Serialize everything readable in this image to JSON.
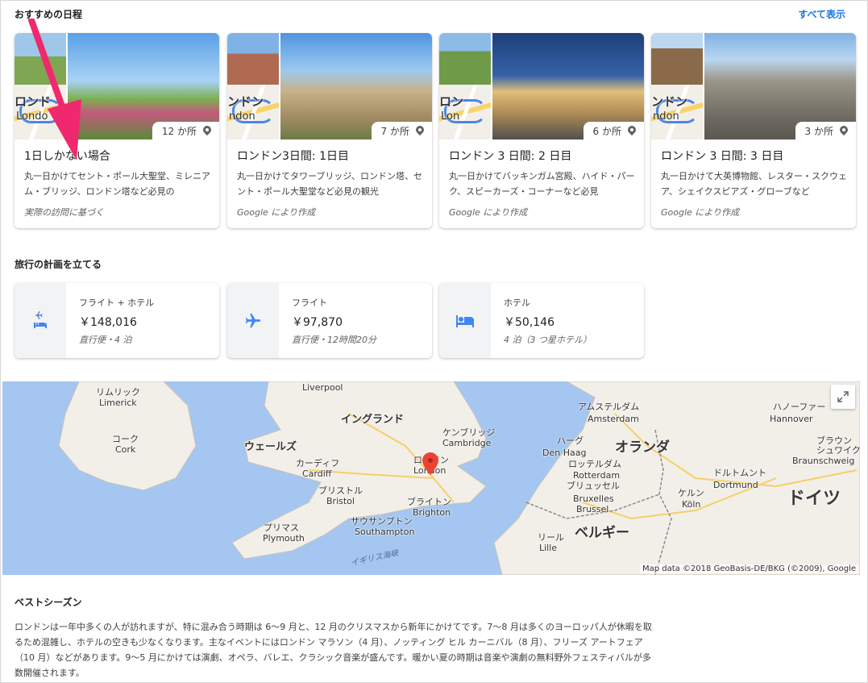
{
  "itineraries": {
    "heading": "おすすめの日程",
    "see_all": "すべて表示",
    "cards": [
      {
        "title": "1日しかない場合",
        "count": "12 か所",
        "map_city": "ロンド",
        "map_city2": "Londo",
        "desc": "丸一日かけてセント・ポール大聖堂、ミレニアム・ブリッジ、ロンドン塔など必見の",
        "source": "実際の訪問に基づく"
      },
      {
        "title": "ロンドン3日間: 1日目",
        "count": "7 か所",
        "map_city": "ンドン",
        "map_city2": "ndon",
        "desc": "丸一日かけてタワーブリッジ、ロンドン塔、セント・ポール大聖堂など必見の観光",
        "source": "Google により作成"
      },
      {
        "title": "ロンドン 3 日間: 2 日目",
        "count": "6 か所",
        "map_city": "ロン",
        "map_city2": "Lon",
        "desc": "丸一日かけてバッキンガム宮殿、ハイド・パーク、スピーカーズ・コーナーなど必見",
        "source": "Google により作成"
      },
      {
        "title": "ロンドン 3 日間: 3 日目",
        "count": "3 か所",
        "map_city": "ンドン",
        "map_city2": "ndon",
        "desc": "丸一日かけて大英博物館、レスター・スクウェア、シェイクスピアズ・グローブなど",
        "source": "Google により作成"
      }
    ]
  },
  "plan": {
    "heading": "旅行の計画を立てる",
    "cards": [
      {
        "label": "フライト + ホテル",
        "price": "￥148,016",
        "sub": "直行便・4 泊",
        "icon": "flight-hotel-icon"
      },
      {
        "label": "フライト",
        "price": "￥97,870",
        "sub": "直行便・12時間20分",
        "icon": "airplane-icon"
      },
      {
        "label": "ホテル",
        "price": "￥50,146",
        "sub": "4 泊（3 つ星ホテル）",
        "icon": "bed-icon"
      }
    ]
  },
  "map": {
    "labels": {
      "liverpool": "Liverpool",
      "limerick_ja": "リムリック",
      "limerick": "Limerick",
      "cork_ja": "コーク",
      "cork": "Cork",
      "england": "イングランド",
      "wales": "ウェールズ",
      "cardiff_ja": "カーディフ",
      "cardiff": "Cardiff",
      "bristol_ja": "ブリストル",
      "bristol": "Bristol",
      "plymouth_ja": "プリマス",
      "plymouth": "Plymouth",
      "southampton_ja": "サウサンプトン",
      "southampton": "Southampton",
      "brighton_ja": "ブライトン",
      "brighton": "Brighton",
      "cambridge_ja": "ケンブリッジ",
      "cambridge": "Cambridge",
      "london_ja": "ロンドン",
      "london": "London",
      "channel": "イギリス海峡",
      "amsterdam_ja": "アムステルダム",
      "amsterdam": "Amsterdam",
      "hague_ja": "ハーグ",
      "hague": "Den Haag",
      "rotterdam_ja": "ロッテルダム",
      "rotterdam": "Rotterdam",
      "netherlands": "オランダ",
      "brussels_ja": "ブリュッセル",
      "brussels1": "Bruxelles",
      "brussels2": "Brussel",
      "belgium": "ベルギー",
      "lille_ja": "リール",
      "lille": "Lille",
      "hanover_ja": "ハノーファー",
      "hanover": "Hannover",
      "braunschweig_ja": "ブラウン\nシュワイク",
      "braunschweig": "Braunschweig",
      "dortmund_ja": "ドルトムント",
      "dortmund": "Dortmund",
      "cologne_ja": "ケルン",
      "cologne": "Köln",
      "germany": "ドイツ"
    },
    "attribution": "Map data ©2018 GeoBasis-DE/BKG (©2009), Google"
  },
  "best_season": {
    "heading": "ベストシーズン",
    "body": "ロンドンは一年中多くの人が訪れますが、特に混み合う時期は 6〜9 月と、12 月のクリスマスから新年にかけてです。7〜8 月は多くのヨーロッパ人が休暇を取るため混雑し、ホテルの空きも少なくなります。主なイベントにはロンドン マラソン（4 月）、ノッティング ヒル カーニバル（8 月）、フリーズ アートフェア（10 月）などがあります。9〜5 月にかけては演劇、オペラ、バレエ、クラシック音楽が盛んです。暖かい夏の時期は音楽や演劇の無料野外フェスティバルが多数開催されます。"
  },
  "colors": {
    "accent": "#1a73e8",
    "icon_blue": "#4285f4",
    "arrow_pink": "#f0286e",
    "pin_red": "#ea4335",
    "sea": "#a5c6f0",
    "land": "#f2efe9"
  }
}
